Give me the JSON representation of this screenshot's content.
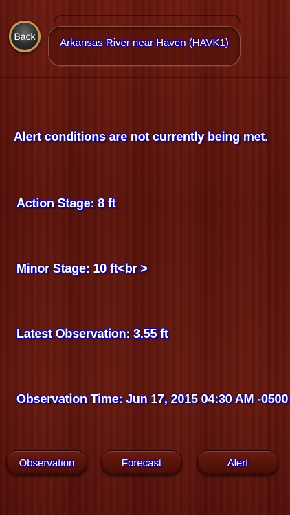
{
  "header": {
    "back_label": "Back",
    "title": "Arkansas River near Haven (HAVK1)"
  },
  "alert_info": {
    "status": "Alert conditions are not currently being met.",
    "action_stage": "Action Stage: 8 ft",
    "minor_stage": "Minor Stage: 10 ft<br >",
    "latest_observation": "Latest Observation: 3.55 ft",
    "observation_time": "Observation Time: Jun 17, 2015 04:30 AM -0500"
  },
  "bottom_nav": {
    "observation_label": "Observation",
    "forecast_label": "Forecast",
    "alert_label": "Alert"
  },
  "colors": {
    "background": "#5e150d",
    "text_outline": "#1d0a8c",
    "back_button_ring": "#c99a55"
  }
}
